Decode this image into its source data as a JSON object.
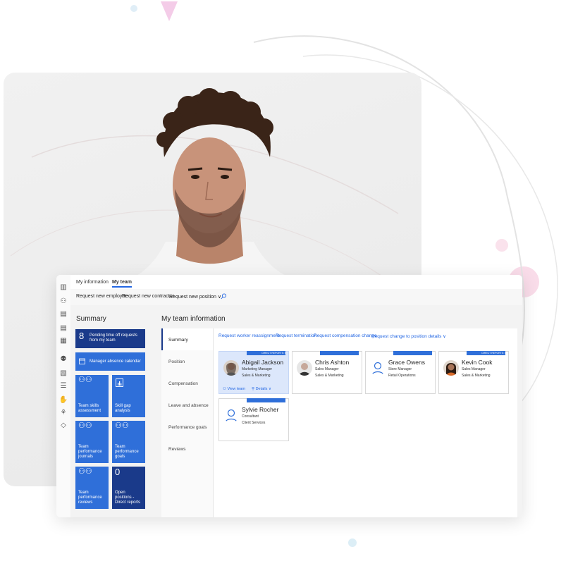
{
  "tabs": [
    {
      "label": "My information"
    },
    {
      "label": "My team"
    }
  ],
  "actions": [
    {
      "label": "Request new employee"
    },
    {
      "label": "Request new contractor"
    },
    {
      "label": "Request new position ∨"
    }
  ],
  "summary": {
    "title": "Summary",
    "pending_count": "8",
    "pending_label": "Pending time off requests from my team",
    "calendar_label": "Manager absence calendar",
    "tiles": [
      {
        "label": "Team skills assessment"
      },
      {
        "label": "Skill gap analysis"
      },
      {
        "label": "Team performance journals"
      },
      {
        "label": "Team performance goals"
      },
      {
        "label": "Team performance reviews"
      }
    ],
    "open_count": "0",
    "open_label": "Open positions - Direct reports"
  },
  "team": {
    "title": "My team information",
    "vtabs": [
      {
        "label": "Summary"
      },
      {
        "label": "Position"
      },
      {
        "label": "Compensation"
      },
      {
        "label": "Leave and absence"
      },
      {
        "label": "Performance goals"
      },
      {
        "label": "Reviews"
      }
    ],
    "links": [
      {
        "label": "Request worker reassignment"
      },
      {
        "label": "Request termination"
      },
      {
        "label": "Request compensation change"
      },
      {
        "label": "Request change to position details ∨"
      }
    ],
    "cards": [
      {
        "name": "Abigail Jackson",
        "role": "Marketing Manager",
        "dept": "Sales & Marketing",
        "badge": "DIRECT REPORTS: 5"
      },
      {
        "name": "Chris Ashton",
        "role": "Sales Manager",
        "dept": "Sales & Marketing",
        "badge": ""
      },
      {
        "name": "Grace Owens",
        "role": "Store Manager",
        "dept": "Retail Operations",
        "badge": ""
      },
      {
        "name": "Kevin Cook",
        "role": "Sales Manager",
        "dept": "Sales & Marketing",
        "badge": "DIRECT REPORTS: 4"
      },
      {
        "name": "Sylvie Rocher",
        "role": "Consultant",
        "dept": "Client Services",
        "badge": ""
      }
    ],
    "view_team": "View team",
    "details": "Details ∨"
  },
  "colors": {
    "accent": "#2266e3",
    "tile": "#2f6fd9",
    "tile_dark": "#1a3a8a",
    "selected_card": "#dce7fb"
  }
}
